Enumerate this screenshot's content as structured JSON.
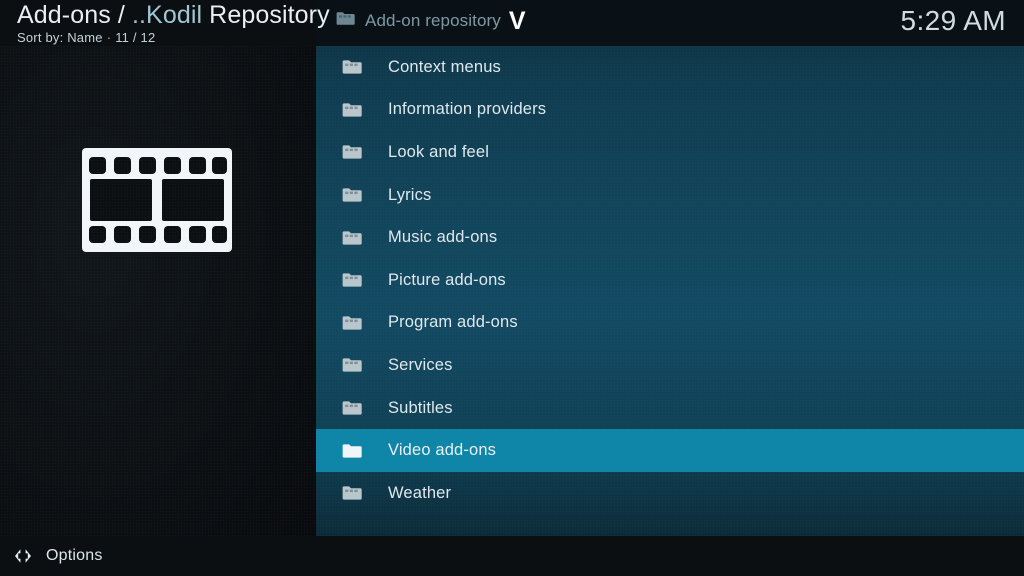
{
  "header": {
    "title_prefix": "Add-ons / ",
    "title_folder": "..Kodil",
    "title_suffix": " Repository",
    "sort_label": "Sort by: Name",
    "separator": "·",
    "counter": "11 / 12",
    "breadcrumb_icon": "folder-icon",
    "breadcrumb_label": "Add-on repository",
    "breadcrumb_caret": "V",
    "clock": "5:29 AM"
  },
  "preview": {
    "icon": "film-strip-icon"
  },
  "list": {
    "items": [
      {
        "label": "Context menus",
        "icon": "folder-icon",
        "selected": false
      },
      {
        "label": "Information providers",
        "icon": "folder-icon",
        "selected": false
      },
      {
        "label": "Look and feel",
        "icon": "folder-icon",
        "selected": false
      },
      {
        "label": "Lyrics",
        "icon": "folder-icon",
        "selected": false
      },
      {
        "label": "Music add-ons",
        "icon": "folder-icon",
        "selected": false
      },
      {
        "label": "Picture add-ons",
        "icon": "folder-icon",
        "selected": false
      },
      {
        "label": "Program add-ons",
        "icon": "folder-icon",
        "selected": false
      },
      {
        "label": "Services",
        "icon": "folder-icon",
        "selected": false
      },
      {
        "label": "Subtitles",
        "icon": "folder-icon",
        "selected": false
      },
      {
        "label": "Video add-ons",
        "icon": "folder-icon",
        "selected": true
      },
      {
        "label": "Weather",
        "icon": "folder-icon",
        "selected": false
      }
    ]
  },
  "footer": {
    "icon": "left-right-arrows-icon",
    "label": "Options"
  },
  "colors": {
    "selection": "#0f86a8",
    "panel_dark": "#0b0e11",
    "panel_teal_mid": "#134a63",
    "text_primary": "#dfe8ec",
    "title_accent": "#9fc6d4"
  }
}
